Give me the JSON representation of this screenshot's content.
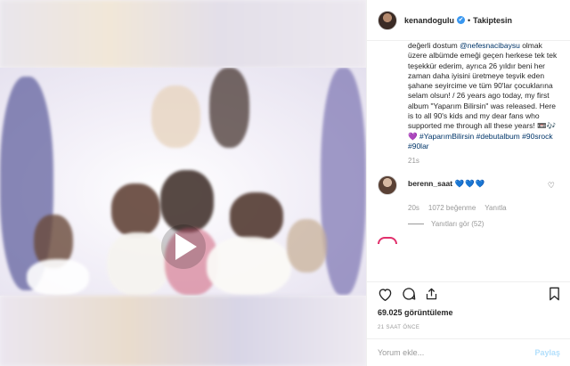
{
  "post": {
    "username": "kenandogulu",
    "verified_glyph": "✔",
    "separator": "•",
    "follow_label": "Takiptesin"
  },
  "caption": {
    "lead": "değerli dostum ",
    "mention": "@nefesnacibaysu",
    "body": " olmak üzere albümde emeği geçen herkese tek tek teşekkür ederim, ayrıca 26 yıldır beni her zaman daha iyisini üretmeye teşvik eden şahane seyircime ve tüm 90'lar çocuklarına selam olsun! / 26 years ago today, my first album \"Yaparım Bilirsin\" was released. Here is to all 90's kids and my dear fans who supported me through all these years! ",
    "emoji": "📼🎶💜",
    "hashtag1": "#YaparımBilirsin",
    "hashtag2": "#debutalbum",
    "hashtag3": "#90srock",
    "hashtag4": "#90lar",
    "time": "21s"
  },
  "comment": {
    "username": "berenn_saat",
    "emoji": "💙💙💙",
    "time": "20s",
    "likes": "1072 beğenme",
    "reply_label": "Yanıtla",
    "view_replies": "Yanıtları gör (52)"
  },
  "stats": {
    "views": "69.025 görüntüleme",
    "time": "21 SAAT ÖNCE"
  },
  "add_comment": {
    "placeholder": "Yorum ekle...",
    "post_label": "Paylaş"
  },
  "colors": {
    "link": "#003569",
    "verified": "#3897f0",
    "muted": "#999999",
    "post_disabled": "#b2dffc"
  },
  "icons": [
    "play-icon",
    "heart-icon",
    "comment-icon",
    "share-icon",
    "bookmark-icon",
    "verified-icon"
  ]
}
